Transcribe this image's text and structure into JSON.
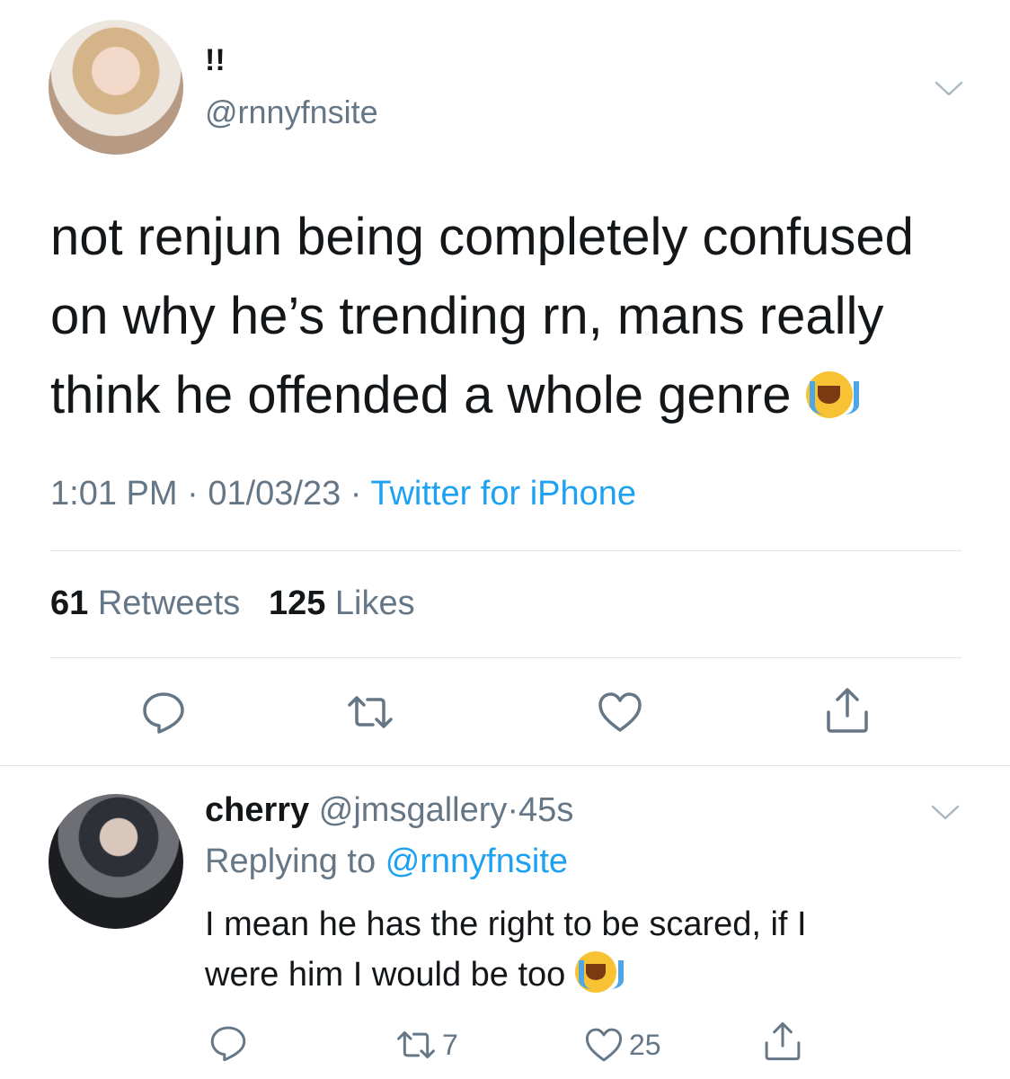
{
  "tweet": {
    "display_name": "!!",
    "handle": "@rnnyfnsite",
    "text_line1": "not renjun being completely confused",
    "text_line2": "on why he’s trending rn, mans really",
    "text_line3": "think he offended a whole genre",
    "emoji": "loudly-crying-face",
    "time": "1:01 PM",
    "date": "01/03/23",
    "separator": "·",
    "source": "Twitter for iPhone",
    "retweets_count": "61",
    "retweets_label": "Retweets",
    "likes_count": "125",
    "likes_label": "Likes"
  },
  "reply": {
    "display_name": "cherry",
    "handle": "@jmsgallery",
    "separator": "·",
    "time_ago": "45s",
    "replying_label": "Replying to",
    "replying_handle": "@rnnyfnsite",
    "text_line1": "I mean he has the right to be scared, if I",
    "text_line2": "were him I would be too",
    "retweet_count": "7",
    "like_count": "25"
  },
  "colors": {
    "text": "#14171a",
    "secondary": "#657786",
    "link": "#1da1f2",
    "divider": "#e1e8ed"
  },
  "icons": [
    "chevron-down-icon",
    "reply-icon",
    "retweet-icon",
    "heart-icon",
    "share-icon"
  ]
}
